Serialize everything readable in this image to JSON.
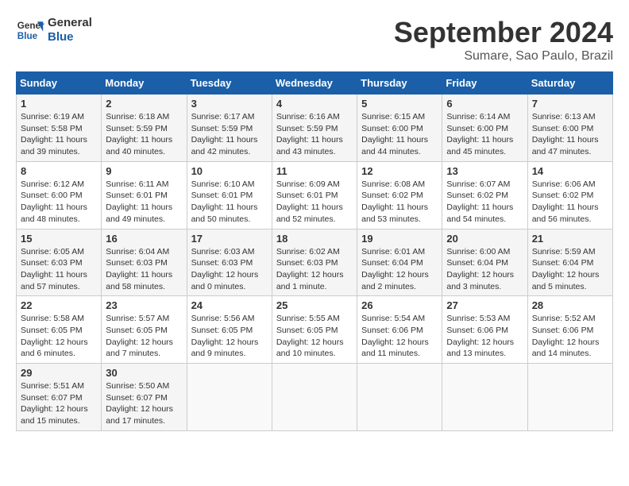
{
  "header": {
    "logo_line1": "General",
    "logo_line2": "Blue",
    "month": "September 2024",
    "location": "Sumare, Sao Paulo, Brazil"
  },
  "days_of_week": [
    "Sunday",
    "Monday",
    "Tuesday",
    "Wednesday",
    "Thursday",
    "Friday",
    "Saturday"
  ],
  "weeks": [
    [
      {
        "day": "1",
        "info": "Sunrise: 6:19 AM\nSunset: 5:58 PM\nDaylight: 11 hours\nand 39 minutes."
      },
      {
        "day": "2",
        "info": "Sunrise: 6:18 AM\nSunset: 5:59 PM\nDaylight: 11 hours\nand 40 minutes."
      },
      {
        "day": "3",
        "info": "Sunrise: 6:17 AM\nSunset: 5:59 PM\nDaylight: 11 hours\nand 42 minutes."
      },
      {
        "day": "4",
        "info": "Sunrise: 6:16 AM\nSunset: 5:59 PM\nDaylight: 11 hours\nand 43 minutes."
      },
      {
        "day": "5",
        "info": "Sunrise: 6:15 AM\nSunset: 6:00 PM\nDaylight: 11 hours\nand 44 minutes."
      },
      {
        "day": "6",
        "info": "Sunrise: 6:14 AM\nSunset: 6:00 PM\nDaylight: 11 hours\nand 45 minutes."
      },
      {
        "day": "7",
        "info": "Sunrise: 6:13 AM\nSunset: 6:00 PM\nDaylight: 11 hours\nand 47 minutes."
      }
    ],
    [
      {
        "day": "8",
        "info": "Sunrise: 6:12 AM\nSunset: 6:00 PM\nDaylight: 11 hours\nand 48 minutes."
      },
      {
        "day": "9",
        "info": "Sunrise: 6:11 AM\nSunset: 6:01 PM\nDaylight: 11 hours\nand 49 minutes."
      },
      {
        "day": "10",
        "info": "Sunrise: 6:10 AM\nSunset: 6:01 PM\nDaylight: 11 hours\nand 50 minutes."
      },
      {
        "day": "11",
        "info": "Sunrise: 6:09 AM\nSunset: 6:01 PM\nDaylight: 11 hours\nand 52 minutes."
      },
      {
        "day": "12",
        "info": "Sunrise: 6:08 AM\nSunset: 6:02 PM\nDaylight: 11 hours\nand 53 minutes."
      },
      {
        "day": "13",
        "info": "Sunrise: 6:07 AM\nSunset: 6:02 PM\nDaylight: 11 hours\nand 54 minutes."
      },
      {
        "day": "14",
        "info": "Sunrise: 6:06 AM\nSunset: 6:02 PM\nDaylight: 11 hours\nand 56 minutes."
      }
    ],
    [
      {
        "day": "15",
        "info": "Sunrise: 6:05 AM\nSunset: 6:03 PM\nDaylight: 11 hours\nand 57 minutes."
      },
      {
        "day": "16",
        "info": "Sunrise: 6:04 AM\nSunset: 6:03 PM\nDaylight: 11 hours\nand 58 minutes."
      },
      {
        "day": "17",
        "info": "Sunrise: 6:03 AM\nSunset: 6:03 PM\nDaylight: 12 hours\nand 0 minutes."
      },
      {
        "day": "18",
        "info": "Sunrise: 6:02 AM\nSunset: 6:03 PM\nDaylight: 12 hours\nand 1 minute."
      },
      {
        "day": "19",
        "info": "Sunrise: 6:01 AM\nSunset: 6:04 PM\nDaylight: 12 hours\nand 2 minutes."
      },
      {
        "day": "20",
        "info": "Sunrise: 6:00 AM\nSunset: 6:04 PM\nDaylight: 12 hours\nand 3 minutes."
      },
      {
        "day": "21",
        "info": "Sunrise: 5:59 AM\nSunset: 6:04 PM\nDaylight: 12 hours\nand 5 minutes."
      }
    ],
    [
      {
        "day": "22",
        "info": "Sunrise: 5:58 AM\nSunset: 6:05 PM\nDaylight: 12 hours\nand 6 minutes."
      },
      {
        "day": "23",
        "info": "Sunrise: 5:57 AM\nSunset: 6:05 PM\nDaylight: 12 hours\nand 7 minutes."
      },
      {
        "day": "24",
        "info": "Sunrise: 5:56 AM\nSunset: 6:05 PM\nDaylight: 12 hours\nand 9 minutes."
      },
      {
        "day": "25",
        "info": "Sunrise: 5:55 AM\nSunset: 6:05 PM\nDaylight: 12 hours\nand 10 minutes."
      },
      {
        "day": "26",
        "info": "Sunrise: 5:54 AM\nSunset: 6:06 PM\nDaylight: 12 hours\nand 11 minutes."
      },
      {
        "day": "27",
        "info": "Sunrise: 5:53 AM\nSunset: 6:06 PM\nDaylight: 12 hours\nand 13 minutes."
      },
      {
        "day": "28",
        "info": "Sunrise: 5:52 AM\nSunset: 6:06 PM\nDaylight: 12 hours\nand 14 minutes."
      }
    ],
    [
      {
        "day": "29",
        "info": "Sunrise: 5:51 AM\nSunset: 6:07 PM\nDaylight: 12 hours\nand 15 minutes."
      },
      {
        "day": "30",
        "info": "Sunrise: 5:50 AM\nSunset: 6:07 PM\nDaylight: 12 hours\nand 17 minutes."
      },
      {
        "day": "",
        "info": ""
      },
      {
        "day": "",
        "info": ""
      },
      {
        "day": "",
        "info": ""
      },
      {
        "day": "",
        "info": ""
      },
      {
        "day": "",
        "info": ""
      }
    ]
  ]
}
